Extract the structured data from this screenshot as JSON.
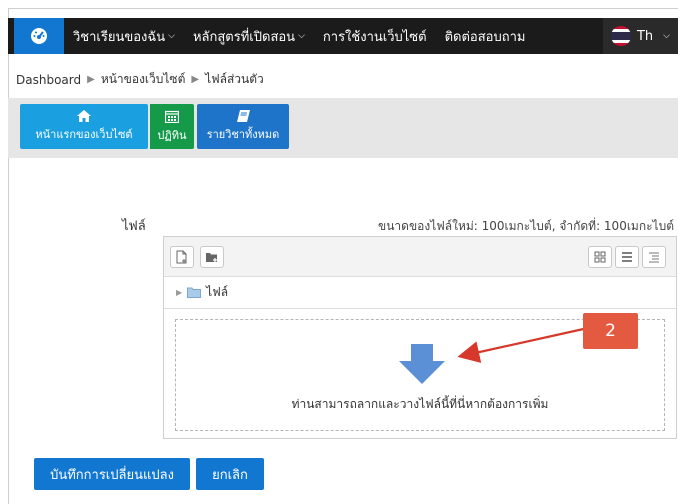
{
  "navbar": {
    "items": [
      {
        "label": "วิชาเรียนของฉัน",
        "has_caret": true
      },
      {
        "label": "หลักสูตรที่เปิดสอน",
        "has_caret": true
      },
      {
        "label": "การใช้งานเว็บไซต์",
        "has_caret": false
      },
      {
        "label": "ติดต่อสอบถาม",
        "has_caret": false
      }
    ],
    "language": "Th",
    "caret": "⌵"
  },
  "breadcrumb": {
    "items": [
      "Dashboard",
      "หน้าของเว็บไซต์",
      "ไฟล์ส่วนตัว"
    ],
    "separator": "▶"
  },
  "quick_buttons": {
    "home": "หน้าแรกของเว็บไซต์",
    "calendar": "ปฏิทิน",
    "courses": "รายวิชาทั้งหมด"
  },
  "files": {
    "label": "ไฟล์",
    "size_info": "ขนาดของไฟล์ใหม่: 100เมกะไบต์, จำกัดที่: 100เมกะไบต์",
    "path_folder": "ไฟล์",
    "dropzone_text": "ท่านสามารถลากและวางไฟล์นี้ที่นี่หากต้องการเพิ่ม"
  },
  "annotation": {
    "badge": "2"
  },
  "footer": {
    "save": "บันทึกการเปลี่ยนแปลง",
    "cancel": "ยกเลิก"
  },
  "colors": {
    "navbar_bg": "#1b1b1b",
    "primary_blue": "#1177d1",
    "calendar_green": "#159a4a",
    "annotation_red": "#e35a41"
  }
}
